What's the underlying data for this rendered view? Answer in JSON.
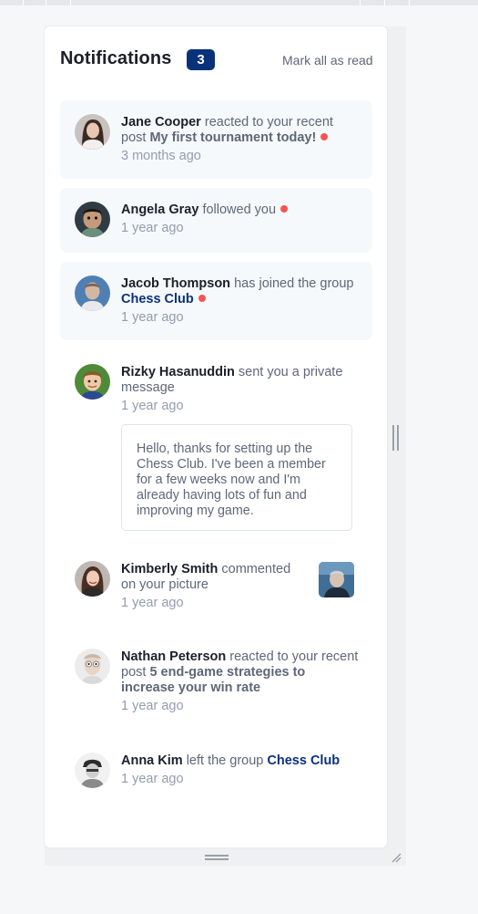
{
  "header": {
    "title": "Notifications",
    "unread_count": "3",
    "mark_all_label": "Mark all as read"
  },
  "notifications": [
    {
      "user": "Jane Cooper",
      "action": "reacted to your recent post",
      "target": "My first tournament today!",
      "target_type": "post",
      "time": "3 months ago",
      "unread": true,
      "avatar_icon": "avatar-jane-cooper"
    },
    {
      "user": "Angela Gray",
      "action": "followed you",
      "time": "1 year ago",
      "unread": true,
      "avatar_icon": "avatar-angela-gray"
    },
    {
      "user": "Jacob Thompson",
      "action": "has joined the group",
      "target": "Chess Club",
      "target_type": "group",
      "time": "1 year ago",
      "unread": true,
      "avatar_icon": "avatar-jacob-thompson"
    },
    {
      "user": "Rizky Hasanuddin",
      "action": "sent you a private message",
      "time": "1 year ago",
      "unread": false,
      "message": "Hello, thanks for setting up the Chess Club. I've been a member for a few weeks now and I'm already having lots of fun and improving my game.",
      "avatar_icon": "avatar-rizky-hasanuddin"
    },
    {
      "user": "Kimberly Smith",
      "action": "commented on your picture",
      "time": "1 year ago",
      "unread": false,
      "has_picture": true,
      "avatar_icon": "avatar-kimberly-smith"
    },
    {
      "user": "Nathan Peterson",
      "action": "reacted to your recent post",
      "target": "5 end-game strategies to increase your win rate",
      "target_type": "post",
      "time": "1 year ago",
      "unread": false,
      "avatar_icon": "avatar-nathan-peterson"
    },
    {
      "user": "Anna Kim",
      "action": "left the group",
      "target": "Chess Club",
      "target_type": "group",
      "time": "1 year ago",
      "unread": false,
      "avatar_icon": "avatar-anna-kim"
    }
  ],
  "colors": {
    "accent": "#0a327b",
    "unread_dot": "#f65552",
    "unread_bg": "#f6f9fc",
    "text_dark": "#1c202b",
    "text_muted": "#5e6778",
    "text_time": "#939cad"
  }
}
